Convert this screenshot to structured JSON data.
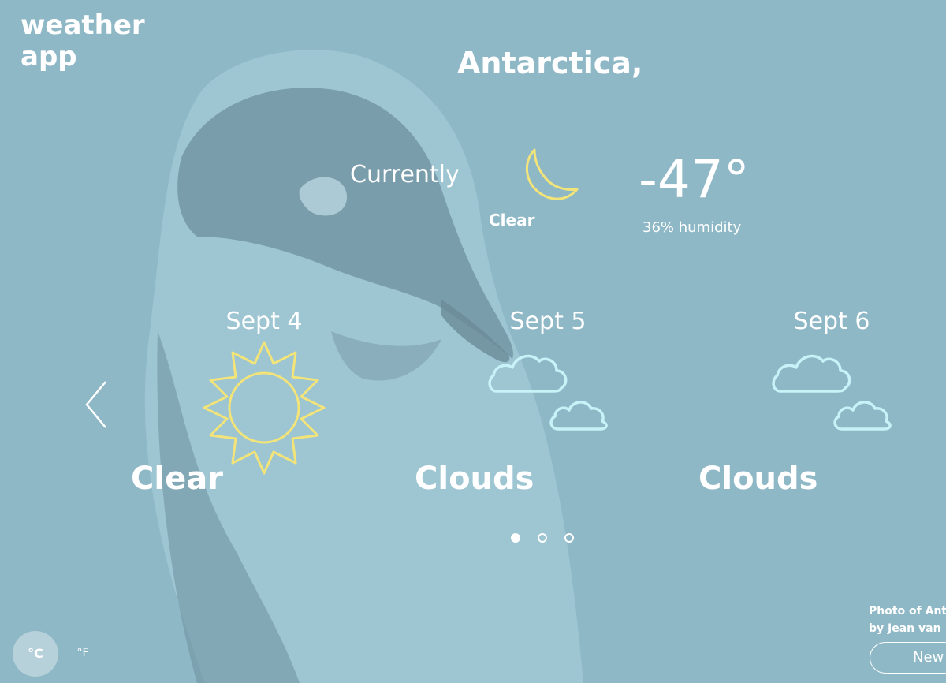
{
  "app": {
    "title": "weather app"
  },
  "location": "Antarctica,",
  "current": {
    "label": "Currently",
    "condition": "Clear",
    "icon": "moon-icon",
    "temperature": "-47°",
    "humidity": "36% humidity"
  },
  "forecast": [
    {
      "date": "Sept 4",
      "condition": "Clear",
      "icon": "sun-icon"
    },
    {
      "date": "Sept 5",
      "condition": "Clouds",
      "icon": "clouds-icon"
    },
    {
      "date": "Sept 6",
      "condition": "Clouds",
      "icon": "clouds-icon"
    }
  ],
  "pagination": {
    "pages": 3,
    "active": 1
  },
  "units": {
    "celsius": "°C",
    "fahrenheit": "°F",
    "selected": "celsius"
  },
  "credit": {
    "line1": "Photo of Ant",
    "line2": "by Jean van"
  },
  "new_button": {
    "label": "New"
  },
  "colors": {
    "background": "#8fb8c7",
    "sun": "#f3e47a",
    "moon": "#f3e47a",
    "cloud": "#c9f1f8",
    "text": "#ffffff"
  }
}
